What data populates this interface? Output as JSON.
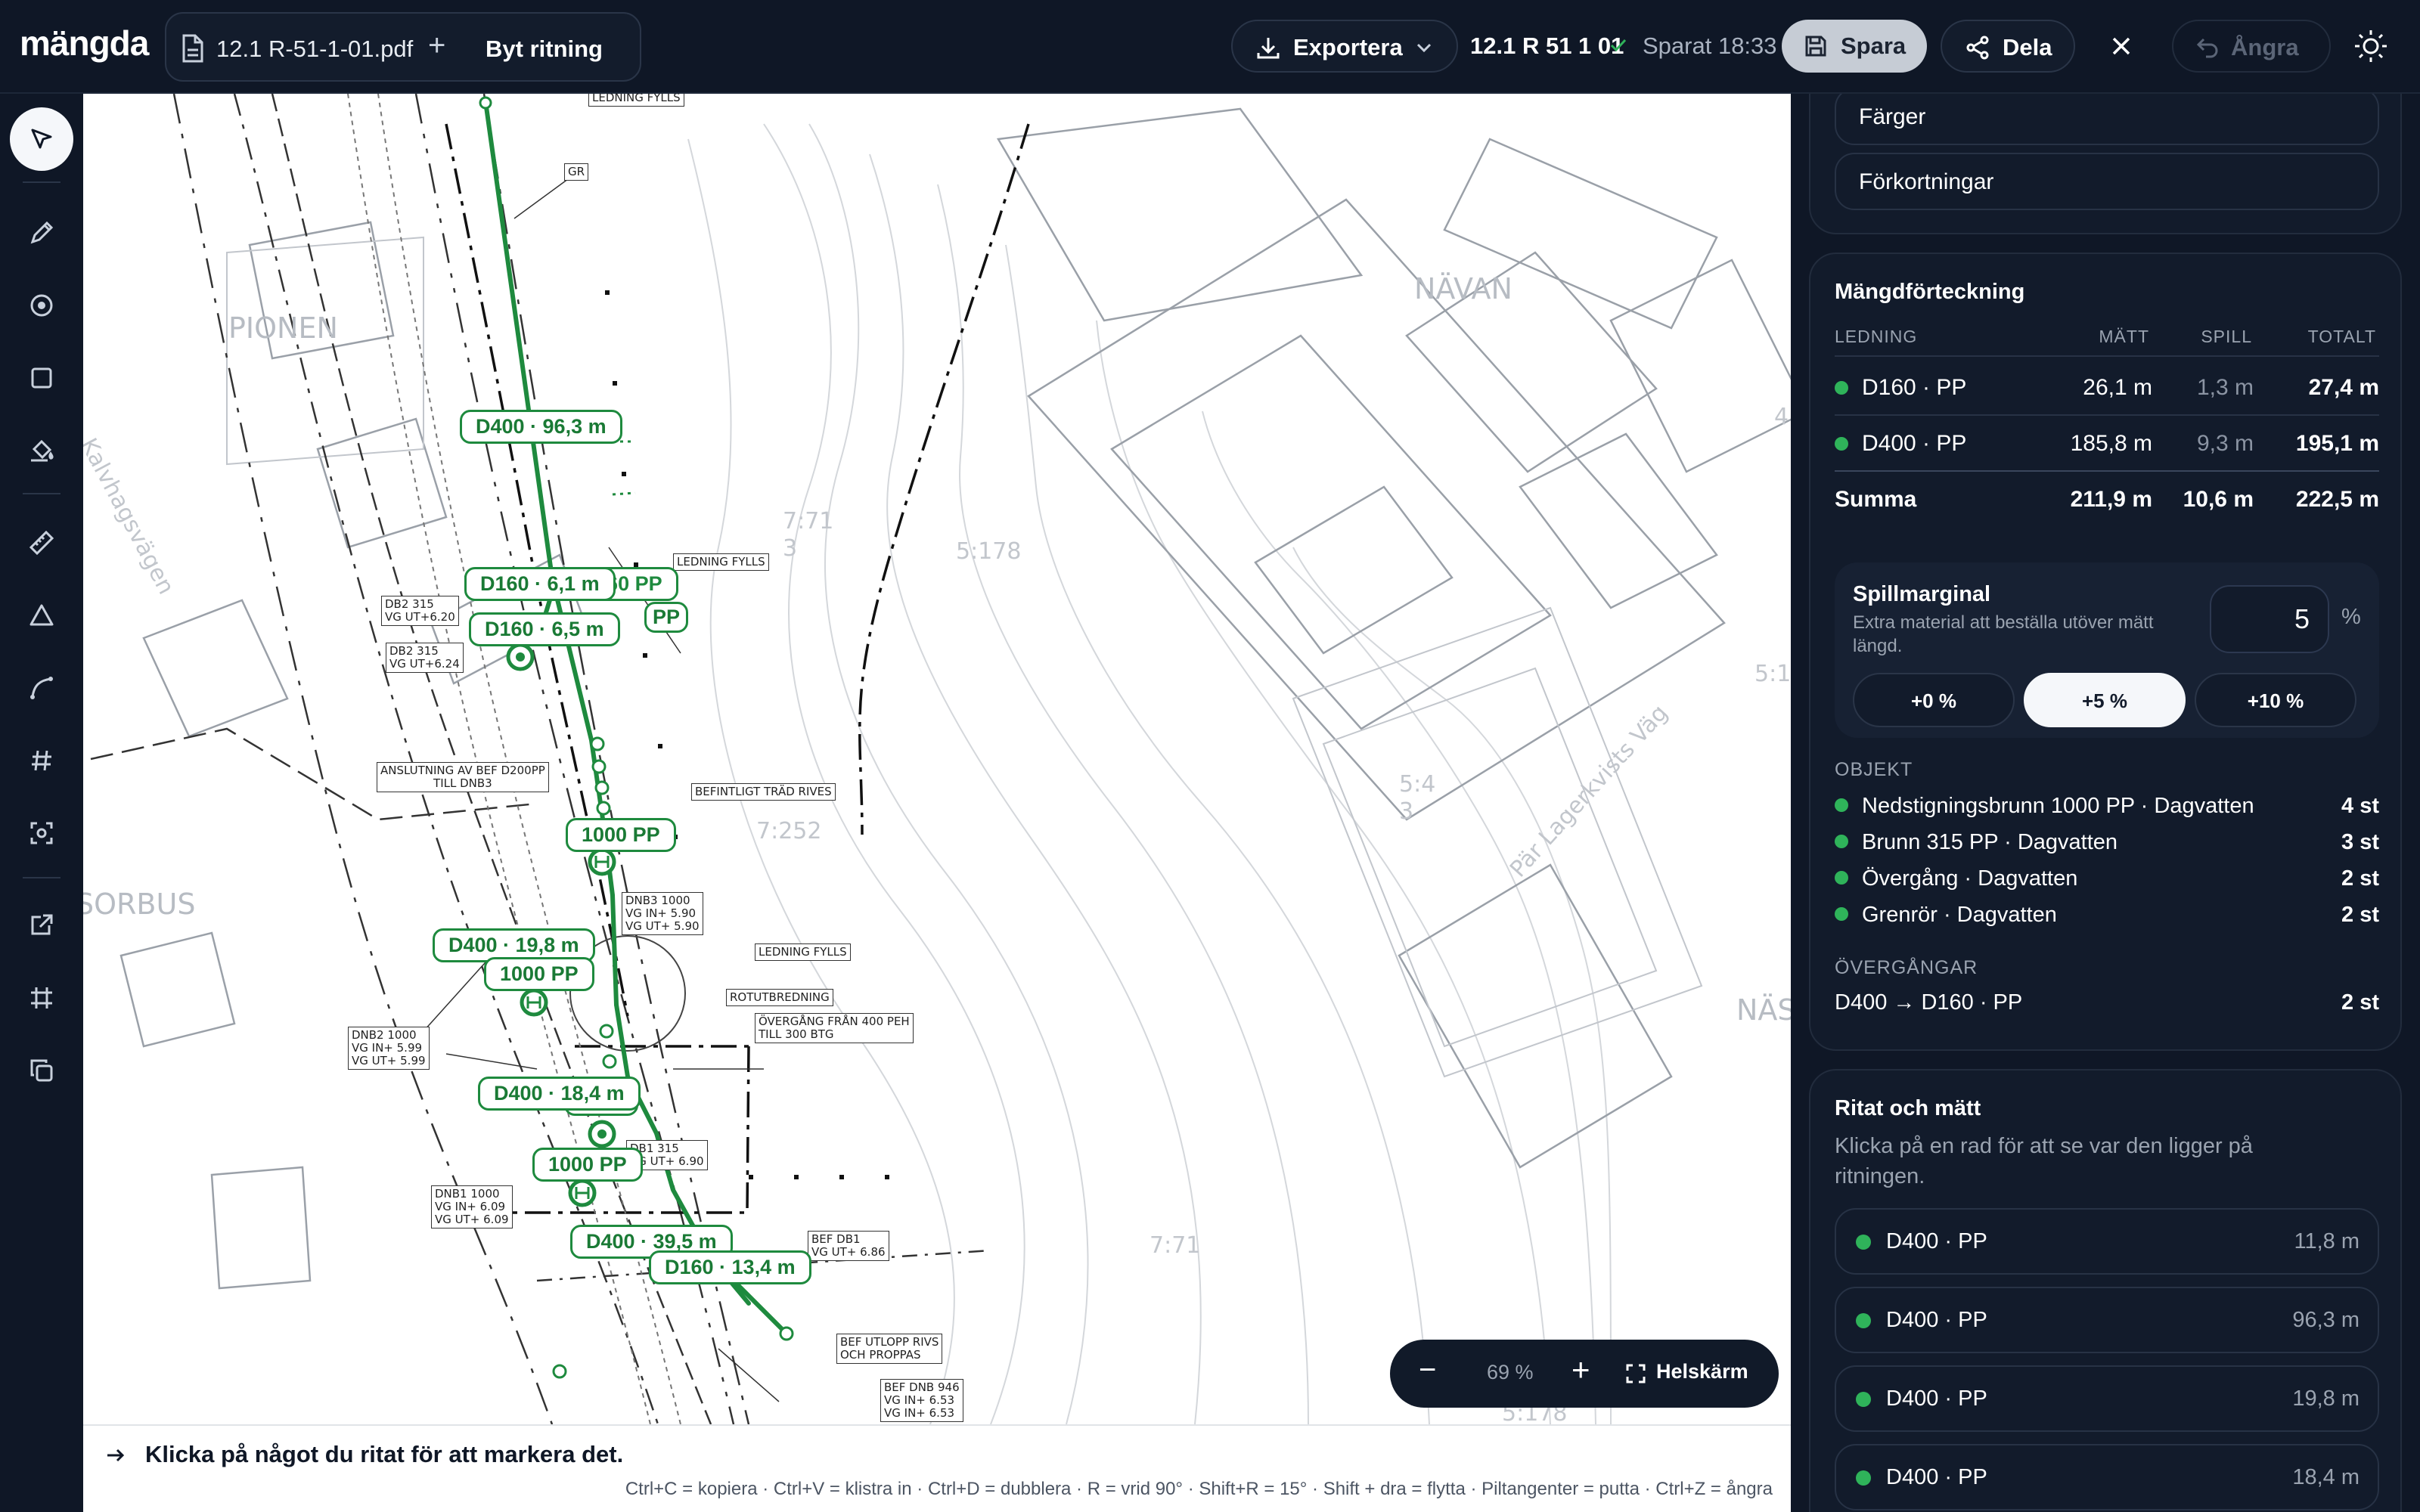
{
  "app": {
    "logo": "mängda"
  },
  "file": {
    "name": "12.1 R-51-1-01.pdf",
    "add": "+",
    "switch_label": "Byt ritning"
  },
  "header": {
    "export_label": "Exportera",
    "doc_id": "12.1 R 51 1 01",
    "saved_text": "Sparat 18:33",
    "save_label": "Spara",
    "share_label": "Dela",
    "undo_label": "Ångra"
  },
  "drawing": {
    "places": [
      "PIONEN",
      "NÄVAN",
      "SORBUS",
      "NÄS",
      "Kalvhagsvägen",
      "Pär Lagerkvists Väg",
      "7:71\n3",
      "5:178",
      "7:252",
      "5:4\n3",
      "5:1",
      "7:71",
      "5:178",
      "4:"
    ],
    "measure_labels": [
      "D400 · 96,3 m",
      "D160 · 6,1 m",
      "D160 · 6,5 m",
      "1000 PP",
      "D400 · 19,8 m",
      "1000 PP",
      "D400 · 18,4 m",
      "1000 PP",
      "D400 · 39,5 m",
      "D160 · 13,4 m",
      "315 PP",
      "D160 · D160 PP",
      "PP"
    ],
    "annotations": [
      "LEDNING FYLLS",
      "GR",
      "LEDNING FYLLS",
      "DB2 315\nVG UT+6.20",
      "DB2 315\nVG UT+6.24",
      "ANSLUTNING AV BEF D200PP\nTILL DNB3",
      "BEFINTLIGT TRÄD RIVES",
      "DNB3 1000\nVG IN+ 5.90\nVG UT+ 5.90",
      "LEDNING FYLLS",
      "ROTUTBREDNING",
      "ÖVERGÅNG FRÅN 400 PEH\nTILL 300 BTG",
      "DNB2 1000\nVG IN+ 5.99\nVG UT+ 5.99",
      "DB1 315\nVG UT+ 6.90",
      "DNB1 1000\nVG IN+ 6.09\nVG UT+ 6.09",
      "BEF DB1\nVG UT+ 6.86",
      "BEF UTLOPP RIVS\nOCH PROPPAS",
      "BEF DNB 946\nVG IN+ 6.53\nVG IN+ 6.53"
    ]
  },
  "zoom": {
    "minus": "−",
    "value": "69 %",
    "plus": "+",
    "fullscreen_label": "Helskärm"
  },
  "status": {
    "hint": "Klicka på något du ritat för att markera det.",
    "shortcuts": "Ctrl+C = kopiera · Ctrl+V = klistra in · Ctrl+D = dubblera · R = vrid 90° · Shift+R = 15° · Shift + dra = flytta · Piltangenter = putta · Ctrl+Z = ångra"
  },
  "panel": {
    "farger_label": "Färger",
    "forkortningar_label": "Förkortningar",
    "quantity": {
      "title": "Mängdförteckning",
      "headers": [
        "LEDNING",
        "MÄTT",
        "SPILL",
        "TOTALT"
      ],
      "rows": [
        {
          "name": "D160 · PP",
          "matt": "26,1 m",
          "spill": "1,3 m",
          "totalt": "27,4 m"
        },
        {
          "name": "D400 · PP",
          "matt": "185,8 m",
          "spill": "9,3 m",
          "totalt": "195,1 m"
        }
      ],
      "sum": {
        "name": "Summa",
        "matt": "211,9 m",
        "spill": "10,6 m",
        "totalt": "222,5 m"
      }
    },
    "spill": {
      "title": "Spillmarginal",
      "desc": "Extra material att beställa utöver mätt längd.",
      "value": "5",
      "unit": "%",
      "options": [
        "+0 %",
        "+5 %",
        "+10 %"
      ],
      "selected": "+5 %"
    },
    "objects": {
      "title": "OBJEKT",
      "items": [
        {
          "name": "Nedstigningsbrunn 1000 PP · Dagvatten",
          "count": "4 st"
        },
        {
          "name": "Brunn 315 PP · Dagvatten",
          "count": "3 st"
        },
        {
          "name": "Övergång · Dagvatten",
          "count": "2 st"
        },
        {
          "name": "Grenrör · Dagvatten",
          "count": "2 st"
        }
      ]
    },
    "transitions": {
      "title": "ÖVERGÅNGAR",
      "items": [
        {
          "name": "D400 → D160 · PP",
          "count": "2 st"
        }
      ]
    },
    "measured": {
      "title": "Ritat och mätt",
      "desc": "Klicka på en rad för att se var den ligger på ritningen.",
      "items": [
        {
          "name": "D400 · PP",
          "length": "11,8 m"
        },
        {
          "name": "D400 · PP",
          "length": "96,3 m"
        },
        {
          "name": "D400 · PP",
          "length": "19,8 m"
        },
        {
          "name": "D400 · PP",
          "length": "18,4 m"
        }
      ]
    }
  },
  "colors": {
    "accent_green": "#1e8a3e",
    "dot_green": "#2fb35a",
    "bg_dark": "#0f1726"
  }
}
